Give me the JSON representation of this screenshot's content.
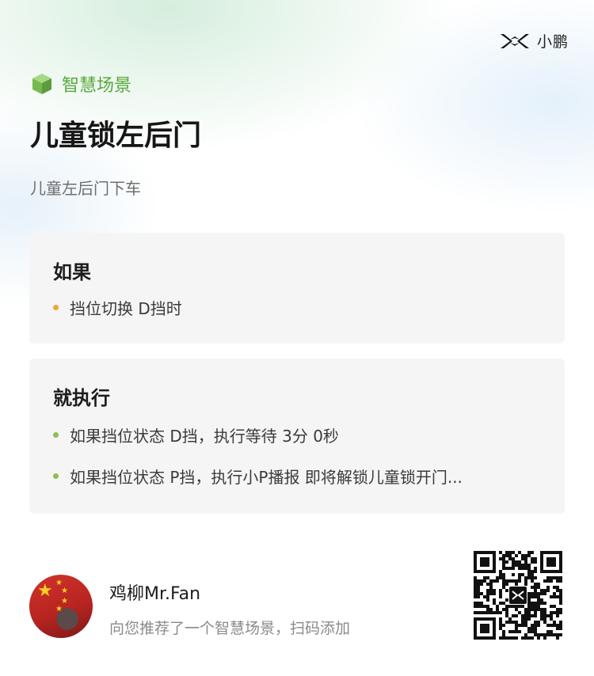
{
  "brand": {
    "name": "小鹏",
    "logo_icon": "xpeng-logo-icon"
  },
  "scene_tag": {
    "label": "智慧场景",
    "icon": "cube-icon",
    "color": "#58a83c"
  },
  "title": "儿童锁左后门",
  "subtitle": "儿童左后门下车",
  "condition": {
    "heading": "如果",
    "items": [
      "挡位切换 D挡时"
    ],
    "bullet_color": "#f0a53a"
  },
  "action": {
    "heading": "就执行",
    "items": [
      "如果挡位状态 D挡，执行等待 3分 0秒",
      "如果挡位状态 P挡，执行小P播报 即将解锁儿童锁开门..."
    ],
    "bullet_color": "#8cc152"
  },
  "share": {
    "user_name": "鸡柳Mr.Fan",
    "message": "向您推荐了一个智慧场景，扫码添加",
    "avatar_icon": "avatar-flag-image",
    "qr_icon": "qr-code"
  }
}
